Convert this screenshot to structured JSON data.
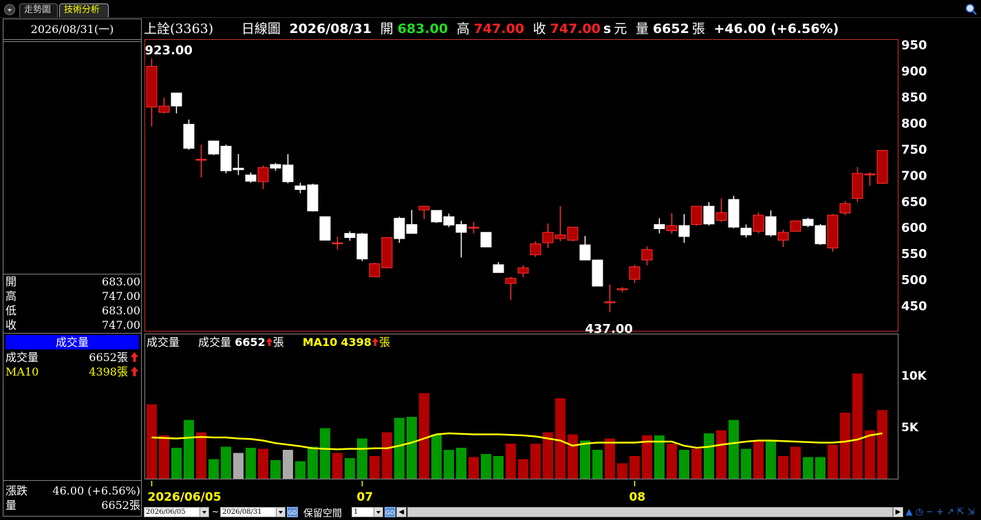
{
  "tabs": {
    "trend": "走勢圖",
    "tech": "技術分析"
  },
  "left": {
    "date": "2026/08/31(一)",
    "ohlc": [
      {
        "k": "開",
        "v": "683.00"
      },
      {
        "k": "高",
        "v": "747.00"
      },
      {
        "k": "低",
        "v": "683.00"
      },
      {
        "k": "收",
        "v": "747.00"
      }
    ],
    "vol_header": "成交量",
    "vol_label": "成交量",
    "vol_value": "6652張",
    "ma_label": "MA10",
    "ma_value": "4398張",
    "chg_label": "漲跌",
    "chg_value": "46.00 (+6.56%)",
    "qty_label": "量",
    "qty_value": "6652張"
  },
  "title": {
    "stock": "上詮(3363)",
    "period": "日線圖",
    "date": "2026/08/31",
    "open_label": "開",
    "open": "683.00",
    "high_label": "高",
    "high": "747.00",
    "close_label": "收",
    "close": "747.00",
    "s": "s",
    "unit": "元",
    "vol_label": "量",
    "vol": "6652",
    "vol_unit": "張",
    "change": "+46.00 (+6.56%)"
  },
  "vol_title": {
    "name": "成交量",
    "vol_label": "成交量",
    "vol_value": "6652",
    "vol_unit": "張",
    "ma_label": "MA10",
    "ma_value": "4398",
    "ma_unit": "張"
  },
  "bottom": {
    "from": "2026/06/05",
    "tilde": "~",
    "to": "2026/08/31",
    "go": "GO",
    "reserve": "保留空間",
    "reserve_value": "1"
  },
  "colors": {
    "up": "#b30000",
    "up_edge": "#ff3333",
    "down": "#ffffff",
    "vol_up": "#b30000",
    "vol_down": "#009900",
    "vol_flat": "#aaaaaa",
    "ma": "#ffff00"
  },
  "chart_data": {
    "type": "candlestick",
    "price_ylim": [
      400,
      960
    ],
    "price_ticks": [
      950,
      900,
      850,
      800,
      750,
      700,
      650,
      600,
      550,
      500,
      450
    ],
    "max_label": "923.00",
    "min_label": "437.00",
    "vol_ylim": [
      0,
      14000
    ],
    "vol_ticks": [
      {
        "v": 10000,
        "label": "10K"
      },
      {
        "v": 5000,
        "label": "5K"
      }
    ],
    "x_labels": [
      {
        "i": 0,
        "label": "2026/06/05"
      },
      {
        "i": 17,
        "label": "07"
      },
      {
        "i": 39,
        "label": "08"
      }
    ],
    "candles": [
      {
        "o": 830,
        "h": 923,
        "l": 793,
        "c": 908,
        "v": 7200
      },
      {
        "o": 820,
        "h": 848,
        "l": 818,
        "c": 832,
        "v": 4200
      },
      {
        "o": 857,
        "h": 857,
        "l": 818,
        "c": 832,
        "v": 3000
      },
      {
        "o": 797,
        "h": 806,
        "l": 748,
        "c": 751,
        "v": 5700
      },
      {
        "o": 730,
        "h": 758,
        "l": 695,
        "c": 730,
        "v": 4500
      },
      {
        "o": 765,
        "h": 765,
        "l": 738,
        "c": 740,
        "v": 1900
      },
      {
        "o": 755,
        "h": 758,
        "l": 703,
        "c": 708,
        "v": 3100
      },
      {
        "o": 713,
        "h": 740,
        "l": 700,
        "c": 710,
        "v": 2500
      },
      {
        "o": 700,
        "h": 705,
        "l": 685,
        "c": 688,
        "v": 3000
      },
      {
        "o": 687,
        "h": 718,
        "l": 673,
        "c": 714,
        "v": 2900
      },
      {
        "o": 720,
        "h": 723,
        "l": 708,
        "c": 713,
        "v": 1800
      },
      {
        "o": 719,
        "h": 740,
        "l": 684,
        "c": 687,
        "v": 2800
      },
      {
        "o": 679,
        "h": 685,
        "l": 665,
        "c": 672,
        "v": 1700
      },
      {
        "o": 681,
        "h": 683,
        "l": 630,
        "c": 631,
        "v": 3100
      },
      {
        "o": 620,
        "h": 620,
        "l": 575,
        "c": 575,
        "v": 4900
      },
      {
        "o": 570,
        "h": 582,
        "l": 557,
        "c": 570,
        "v": 2500
      },
      {
        "o": 588,
        "h": 592,
        "l": 574,
        "c": 580,
        "v": 2000
      },
      {
        "o": 587,
        "h": 589,
        "l": 535,
        "c": 539,
        "v": 3900
      },
      {
        "o": 505,
        "h": 532,
        "l": 505,
        "c": 530,
        "v": 2200
      },
      {
        "o": 522,
        "h": 580,
        "l": 522,
        "c": 580,
        "v": 4500
      },
      {
        "o": 617,
        "h": 620,
        "l": 570,
        "c": 578,
        "v": 5900
      },
      {
        "o": 605,
        "h": 633,
        "l": 588,
        "c": 588,
        "v": 6000
      },
      {
        "o": 633,
        "h": 640,
        "l": 615,
        "c": 640,
        "v": 8300
      },
      {
        "o": 632,
        "h": 632,
        "l": 608,
        "c": 610,
        "v": 4300
      },
      {
        "o": 620,
        "h": 626,
        "l": 600,
        "c": 604,
        "v": 2800
      },
      {
        "o": 605,
        "h": 612,
        "l": 542,
        "c": 590,
        "v": 3000
      },
      {
        "o": 598,
        "h": 610,
        "l": 588,
        "c": 600,
        "v": 2100
      },
      {
        "o": 590,
        "h": 590,
        "l": 562,
        "c": 562,
        "v": 2400
      },
      {
        "o": 528,
        "h": 533,
        "l": 513,
        "c": 513,
        "v": 2200
      },
      {
        "o": 492,
        "h": 505,
        "l": 460,
        "c": 502,
        "v": 3400
      },
      {
        "o": 512,
        "h": 527,
        "l": 504,
        "c": 522,
        "v": 1900
      },
      {
        "o": 547,
        "h": 573,
        "l": 543,
        "c": 568,
        "v": 3400
      },
      {
        "o": 570,
        "h": 607,
        "l": 560,
        "c": 590,
        "v": 4500
      },
      {
        "o": 578,
        "h": 640,
        "l": 573,
        "c": 585,
        "v": 7800
      },
      {
        "o": 575,
        "h": 600,
        "l": 573,
        "c": 600,
        "v": 4300
      },
      {
        "o": 566,
        "h": 583,
        "l": 537,
        "c": 537,
        "v": 3700
      },
      {
        "o": 537,
        "h": 538,
        "l": 487,
        "c": 487,
        "v": 2800
      },
      {
        "o": 457,
        "h": 490,
        "l": 437,
        "c": 457,
        "v": 3900
      },
      {
        "o": 482,
        "h": 485,
        "l": 475,
        "c": 482,
        "v": 1500
      },
      {
        "o": 500,
        "h": 528,
        "l": 493,
        "c": 524,
        "v": 2200
      },
      {
        "o": 537,
        "h": 563,
        "l": 527,
        "c": 557,
        "v": 4200
      },
      {
        "o": 605,
        "h": 617,
        "l": 588,
        "c": 597,
        "v": 4200
      },
      {
        "o": 593,
        "h": 627,
        "l": 587,
        "c": 603,
        "v": 3400
      },
      {
        "o": 603,
        "h": 625,
        "l": 570,
        "c": 582,
        "v": 2800
      },
      {
        "o": 605,
        "h": 640,
        "l": 603,
        "c": 640,
        "v": 2900
      },
      {
        "o": 640,
        "h": 648,
        "l": 603,
        "c": 606,
        "v": 4400
      },
      {
        "o": 613,
        "h": 655,
        "l": 610,
        "c": 628,
        "v": 4700
      },
      {
        "o": 653,
        "h": 660,
        "l": 598,
        "c": 600,
        "v": 5700
      },
      {
        "o": 598,
        "h": 605,
        "l": 580,
        "c": 585,
        "v": 2900
      },
      {
        "o": 592,
        "h": 628,
        "l": 588,
        "c": 623,
        "v": 3700
      },
      {
        "o": 620,
        "h": 632,
        "l": 582,
        "c": 585,
        "v": 3700
      },
      {
        "o": 575,
        "h": 595,
        "l": 562,
        "c": 590,
        "v": 2200
      },
      {
        "o": 592,
        "h": 613,
        "l": 592,
        "c": 612,
        "v": 3100
      },
      {
        "o": 615,
        "h": 618,
        "l": 600,
        "c": 603,
        "v": 2100
      },
      {
        "o": 603,
        "h": 606,
        "l": 566,
        "c": 568,
        "v": 2100
      },
      {
        "o": 560,
        "h": 625,
        "l": 553,
        "c": 623,
        "v": 3300
      },
      {
        "o": 627,
        "h": 650,
        "l": 623,
        "c": 645,
        "v": 6400
      },
      {
        "o": 655,
        "h": 715,
        "l": 648,
        "c": 703,
        "v": 10200
      },
      {
        "o": 702,
        "h": 705,
        "l": 679,
        "c": 702,
        "v": 4700
      },
      {
        "o": 684,
        "h": 748,
        "l": 683,
        "c": 747,
        "v": 6652
      }
    ],
    "flat_vol_idx": [
      7,
      11
    ],
    "ma10": [
      4000,
      3950,
      3900,
      3980,
      4050,
      4000,
      4000,
      3900,
      3850,
      3700,
      3450,
      3300,
      3150,
      2950,
      2900,
      2850,
      2900,
      2900,
      2950,
      2950,
      3200,
      3500,
      3900,
      4300,
      4400,
      4350,
      4300,
      4300,
      4300,
      4250,
      4200,
      4100,
      3900,
      3700,
      3200,
      3400,
      3500,
      3500,
      3500,
      3500,
      3600,
      3600,
      3600,
      3200,
      3000,
      3100,
      3300,
      3450,
      3600,
      3700,
      3700,
      3650,
      3600,
      3550,
      3500,
      3500,
      3600,
      3800,
      4200,
      4398
    ]
  }
}
